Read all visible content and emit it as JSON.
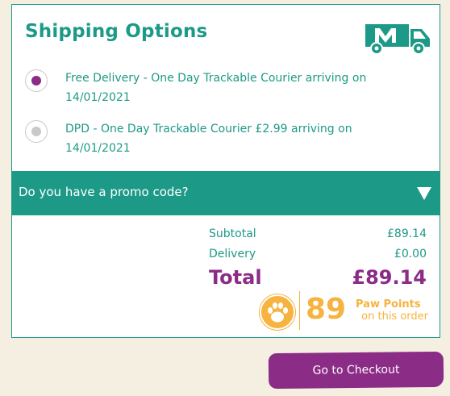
{
  "shipping": {
    "title": "Shipping Options",
    "options": [
      {
        "label": "Free Delivery - One Day Trackable Courier arriving on 14/01/2021",
        "selected": true
      },
      {
        "label": "DPD - One Day Trackable Courier £2.99 arriving on 14/01/2021",
        "selected": false
      }
    ]
  },
  "promo": {
    "label": "Do you have a promo code?"
  },
  "summary": {
    "subtotal_label": "Subtotal",
    "subtotal_value": "£89.14",
    "delivery_label": "Delivery",
    "delivery_value": "£0.00",
    "total_label": "Total",
    "total_value": "£89.14"
  },
  "paw_points": {
    "count": "89",
    "label": "Paw Points",
    "sub": "on this order"
  },
  "checkout": {
    "label": "Go to Checkout"
  },
  "colors": {
    "teal": "#1d9a87",
    "purple": "#8b2c86",
    "gold": "#f6b33f",
    "background": "#f4efe1"
  },
  "icons": [
    "delivery-van-icon",
    "paw-icon",
    "chevron-down-icon"
  ]
}
